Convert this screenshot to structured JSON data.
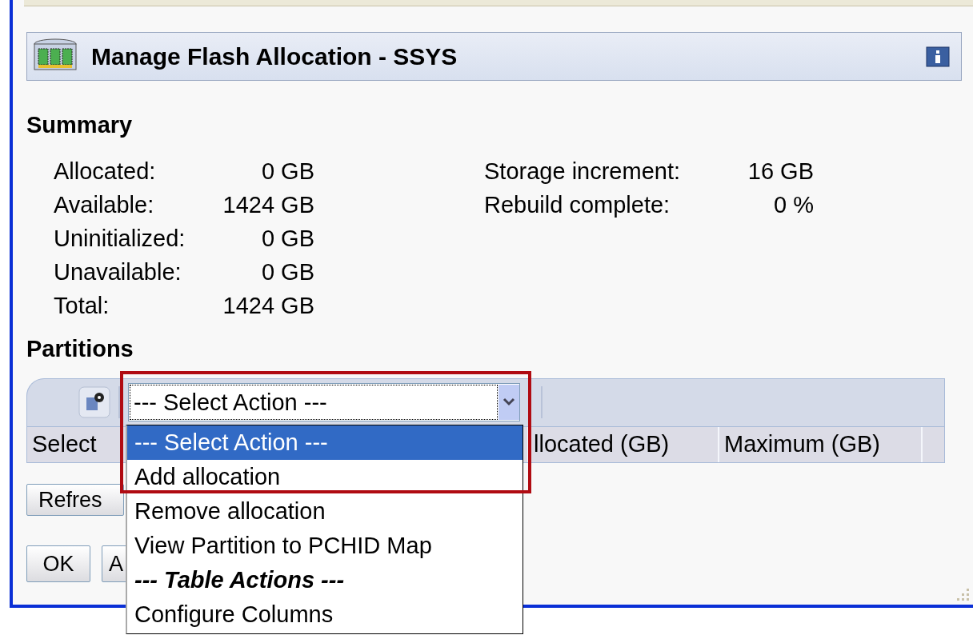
{
  "panel": {
    "title": "Manage Flash Allocation - SSYS"
  },
  "summary": {
    "heading": "Summary",
    "left": [
      {
        "label": "Allocated:",
        "value": "0 GB"
      },
      {
        "label": "Available:",
        "value": "1424 GB"
      },
      {
        "label": "Uninitialized:",
        "value": "0 GB"
      },
      {
        "label": "Unavailable:",
        "value": "0 GB"
      },
      {
        "label": "Total:",
        "value": "1424 GB"
      }
    ],
    "right": [
      {
        "label": "Storage increment:",
        "value": "16 GB"
      },
      {
        "label": "Rebuild complete:",
        "value": "0 %"
      }
    ]
  },
  "partitions": {
    "heading": "Partitions",
    "action_select": {
      "value": "--- Select Action ---",
      "expanded": true
    },
    "columns": [
      "Select",
      "llocated (GB)",
      "Maximum (GB)"
    ],
    "buttons": [
      "Refres"
    ]
  },
  "dropdown_options": [
    {
      "kind": "option",
      "label": "--- Select Action ---",
      "selected": true
    },
    {
      "kind": "option",
      "label": "Add allocation",
      "selected": false
    },
    {
      "kind": "option",
      "label": "Remove allocation",
      "selected": false
    },
    {
      "kind": "option",
      "label": "View Partition to PCHID Map",
      "selected": false
    },
    {
      "kind": "group",
      "label": "--- Table Actions ---",
      "selected": false
    },
    {
      "kind": "option",
      "label": "Configure Columns",
      "selected": false
    }
  ],
  "footer_buttons": [
    "OK",
    "A"
  ]
}
